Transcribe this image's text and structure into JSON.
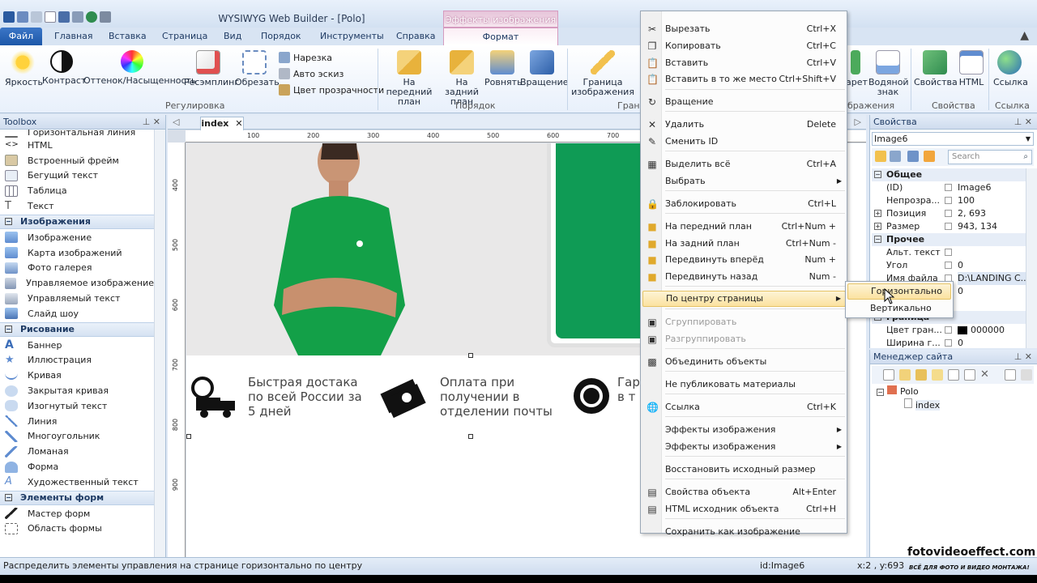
{
  "title_bar": {
    "title": "WYSIWYG Web Builder - [Polo]",
    "context_tab_group": "Эффекты изображения"
  },
  "ribbon_tabs": [
    "Файл",
    "Главная",
    "Вставка",
    "Страница",
    "Вид",
    "Порядок",
    "Инструменты",
    "Справка",
    "Формат"
  ],
  "ribbon": {
    "buttons": {
      "brightness": "Яркость",
      "contrast": "Контраст",
      "hue": "Оттенок/Насыщенность",
      "resample": "Ресэмплинг",
      "crop": "Обрезать",
      "front": "На передний план",
      "back": "На задний план",
      "align": "Ровнять",
      "rotate": "Вращение",
      "border": "Граница изображения",
      "watermark": "Водяной знак",
      "properties": "Свойства",
      "html": "HTML",
      "link": "Ссылка"
    },
    "small": {
      "slice": "Нарезка",
      "autosketch": "Авто эскиз",
      "transparency": "Цвет прозрачности"
    },
    "groups": {
      "adjust": "Регулировка",
      "order": "Порядок",
      "border_trunc": "Грани",
      "effects_trunc": "бражения",
      "props": "Свойства",
      "link": "Ссылка"
    },
    "partial_left": "арет"
  },
  "toolbox": {
    "title": "Toolbox",
    "items_top": [
      "Горизонтальная линия",
      "HTML",
      "Встроенный фрейм",
      "Бегущий текст",
      "Таблица",
      "Текст"
    ],
    "cat_images": "Изображения",
    "items_images": [
      "Изображение",
      "Карта изображений",
      "Фото галерея",
      "Управляемое изображение",
      "Управляемый текст",
      "Слайд шоу"
    ],
    "cat_drawing": "Рисование",
    "items_drawing": [
      "Баннер",
      "Иллюстрация",
      "Кривая",
      "Закрытая кривая",
      "Изогнутый текст",
      "Линия",
      "Многоугольник",
      "Ломаная",
      "Форма",
      "Художественный текст"
    ],
    "cat_forms": "Элементы форм",
    "items_forms": [
      "Мастер форм",
      "Область формы"
    ]
  },
  "document": {
    "tab": "index",
    "ruler_h": [
      "100",
      "200",
      "300",
      "400",
      "500",
      "600",
      "700"
    ],
    "ruler_v": [
      "400",
      "500",
      "600",
      "700",
      "800",
      "900"
    ],
    "features": [
      "Быстрая достака по всей России за 5 дней",
      "Оплата при получении в отделении почты",
      "Гар в т"
    ]
  },
  "context_menu": {
    "items": [
      {
        "label": "Вырезать",
        "shortcut": "Ctrl+X",
        "icon": "scissors-icon"
      },
      {
        "label": "Копировать",
        "shortcut": "Ctrl+C",
        "icon": "copy-icon"
      },
      {
        "label": "Вставить",
        "shortcut": "Ctrl+V",
        "icon": "paste-icon"
      },
      {
        "label": "Вставить в то же место",
        "shortcut": "Ctrl+Shift+V",
        "icon": "paste-same-icon"
      },
      {
        "label": "Вращение",
        "shortcut": "",
        "icon": "rotate-icon"
      },
      {
        "label": "Удалить",
        "shortcut": "Delete",
        "icon": "delete-icon"
      },
      {
        "label": "Сменить ID",
        "shortcut": "",
        "icon": "id-icon"
      },
      {
        "label": "Выделить всё",
        "shortcut": "Ctrl+A",
        "icon": "select-all-icon"
      },
      {
        "label": "Выбрать",
        "shortcut": "",
        "icon": "",
        "submenu": true
      },
      {
        "label": "Заблокировать",
        "shortcut": "Ctrl+L",
        "icon": "lock-icon"
      },
      {
        "label": "На передний план",
        "shortcut": "Ctrl+Num +",
        "icon": "bring-front-icon"
      },
      {
        "label": "На задний план",
        "shortcut": "Ctrl+Num -",
        "icon": "send-back-icon"
      },
      {
        "label": "Передвинуть вперёд",
        "shortcut": "Num +",
        "icon": "forward-icon"
      },
      {
        "label": "Передвинуть назад",
        "shortcut": "Num -",
        "icon": "backward-icon"
      },
      {
        "label": "По центру страницы",
        "shortcut": "",
        "icon": "",
        "submenu": true
      },
      {
        "label": "Сгруппировать",
        "shortcut": "",
        "icon": "group-icon"
      },
      {
        "label": "Разгруппировать",
        "shortcut": "",
        "icon": "ungroup-icon"
      },
      {
        "label": "Объединить объекты",
        "shortcut": "",
        "icon": "merge-icon"
      },
      {
        "label": "Не публиковать материалы",
        "shortcut": "",
        "icon": ""
      },
      {
        "label": "Ссылка",
        "shortcut": "Ctrl+K",
        "icon": "link-icon"
      },
      {
        "label": "Эффекты изображения",
        "shortcut": "",
        "icon": "",
        "submenu": true
      },
      {
        "label": "Эффекты изображения",
        "shortcut": "",
        "icon": "",
        "submenu": true
      },
      {
        "label": "Восстановить исходный размер",
        "shortcut": "",
        "icon": ""
      },
      {
        "label": "Свойства объекта",
        "shortcut": "Alt+Enter",
        "icon": "properties-icon"
      },
      {
        "label": "HTML исходник объекта",
        "shortcut": "Ctrl+H",
        "icon": "html-source-icon"
      },
      {
        "label": "Сохранить как изображение",
        "shortcut": "",
        "icon": ""
      }
    ]
  },
  "submenu": {
    "horizontal": "Горизонтально",
    "vertical": "Вертикально"
  },
  "properties": {
    "title": "Свойства",
    "selected": "Image6",
    "search_placeholder": "Search",
    "cat_general": "Общее",
    "rows_general": [
      {
        "name": "(ID)",
        "value": "Image6"
      },
      {
        "name": "Непрозра...",
        "value": "100"
      },
      {
        "name": "Позиция",
        "value": "2, 693"
      },
      {
        "name": "Размер",
        "value": "943, 134"
      }
    ],
    "cat_other": "Прочее",
    "rows_other": [
      {
        "name": "Альт. текст",
        "value": ""
      },
      {
        "name": "Угол",
        "value": "0"
      },
      {
        "name": "Имя файла",
        "value": "D:\\LANDING C..."
      },
      {
        "name": "",
        "value": "0"
      }
    ],
    "cat_border": "Граница",
    "rows_border": [
      {
        "name": "Цвет гран...",
        "value": "000000"
      },
      {
        "name": "Ширина г...",
        "value": "0"
      }
    ]
  },
  "site_manager": {
    "title": "Менеджер сайта",
    "root": "Polo",
    "page": "index"
  },
  "status": {
    "left": "Распределить элементы управления на странице горизонтально по центру",
    "id": "id:Image6",
    "coords": "x:2 , y:693"
  },
  "watermark": {
    "main": "fotovideoeffect.com",
    "sub": "ВСЁ ДЛЯ ФОТО И ВИДЕО МОНТАЖА!"
  },
  "colors": {
    "accent_blue": "#1d57a8",
    "context_pink": "#d59bbf",
    "highlight": "#fbe2a0",
    "green": "#0f9b55"
  }
}
